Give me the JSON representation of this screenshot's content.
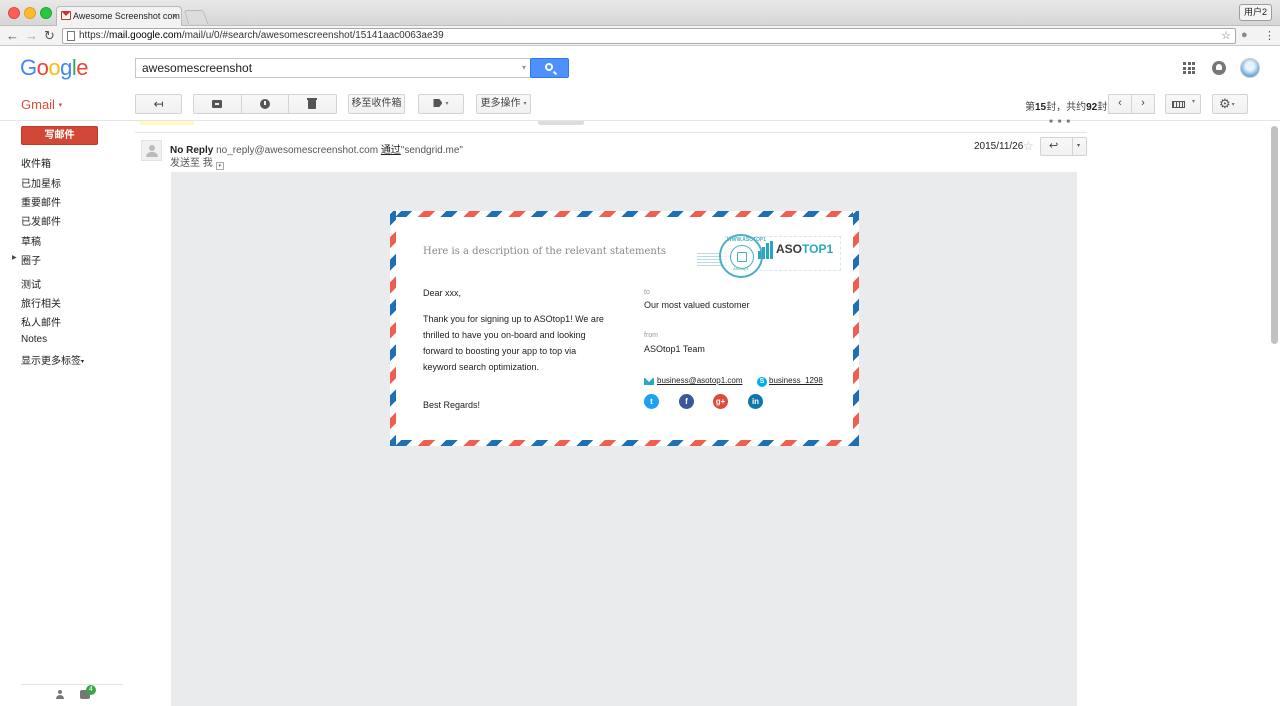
{
  "browser": {
    "tab_title": "Awesome Screenshot com",
    "tab_close": "×",
    "user_button": "用户2",
    "url_prefix": "https://",
    "url_host": "mail.google.com",
    "url_path": "/mail/u/0/#search/awesomescreenshot/15141aac0063ae39",
    "back": "←",
    "forward": "→",
    "reload": "↻",
    "bookmark_star": "☆",
    "menu": "⋮"
  },
  "header": {
    "logo_letters": [
      "G",
      "o",
      "o",
      "g",
      "l",
      "e"
    ],
    "search_value": "awesomescreenshot",
    "search_caret": "▾"
  },
  "toolbar": {
    "gmail_label": "Gmail",
    "gmail_caret": "▾",
    "back_button": "↤",
    "move_to_inbox": "移至收件箱",
    "more_actions": "更多操作",
    "caret": "▾",
    "pager_prefix": "第",
    "pager_current": "15",
    "pager_mid": "封，共约",
    "pager_total": "92",
    "pager_suffix": "封",
    "prev": "‹",
    "next": "›",
    "gear": "⚙"
  },
  "sidebar": {
    "compose": "写邮件",
    "items": [
      {
        "label": "收件箱"
      },
      {
        "label": "已加星标"
      },
      {
        "label": "重要邮件"
      },
      {
        "label": "已发邮件"
      },
      {
        "label": "草稿"
      },
      {
        "label": "圈子"
      },
      {
        "label": "测试"
      },
      {
        "label": "旅行相关"
      },
      {
        "label": "私人邮件"
      },
      {
        "label": "Notes"
      },
      {
        "label": "显示更多标签"
      }
    ],
    "more_caret": "▾",
    "circles_arrow": "▶",
    "hangouts_badge": "4"
  },
  "message": {
    "sender_name": "No Reply",
    "sender_email": "no_reply@awesomescreenshot.com",
    "via_label": "通过",
    "via_domain": "\"sendgrid.me\"",
    "to_label": "发送至 我",
    "to_caret": "▾",
    "date": "2015/11/26",
    "star": "☆",
    "reply": "↩",
    "more": "▾",
    "strip_icons": "■■■"
  },
  "card": {
    "description": "Here is a description of the relevant statements",
    "brand_a": "ASO",
    "brand_b": "TOP1",
    "postmark_top": "WWW.ASOTOP1",
    "postmark_bottom": "AsOtop1",
    "greeting": "Dear xxx,",
    "body": "Thank you for signing up to ASOtop1! We are thrilled to have you on-board and looking forward to boosting your app to top via keyword search optimization.",
    "closing": "Best Regards!",
    "to_label": "to",
    "to_value": "Our most valued customer",
    "from_label": "from",
    "from_value": "ASOtop1 Team",
    "email": "business@asotop1.com",
    "skype": "business_1298",
    "skype_glyph": "S",
    "social": {
      "twitter": "t",
      "facebook": "f",
      "gplus": "g+",
      "linkedin": "in"
    }
  }
}
